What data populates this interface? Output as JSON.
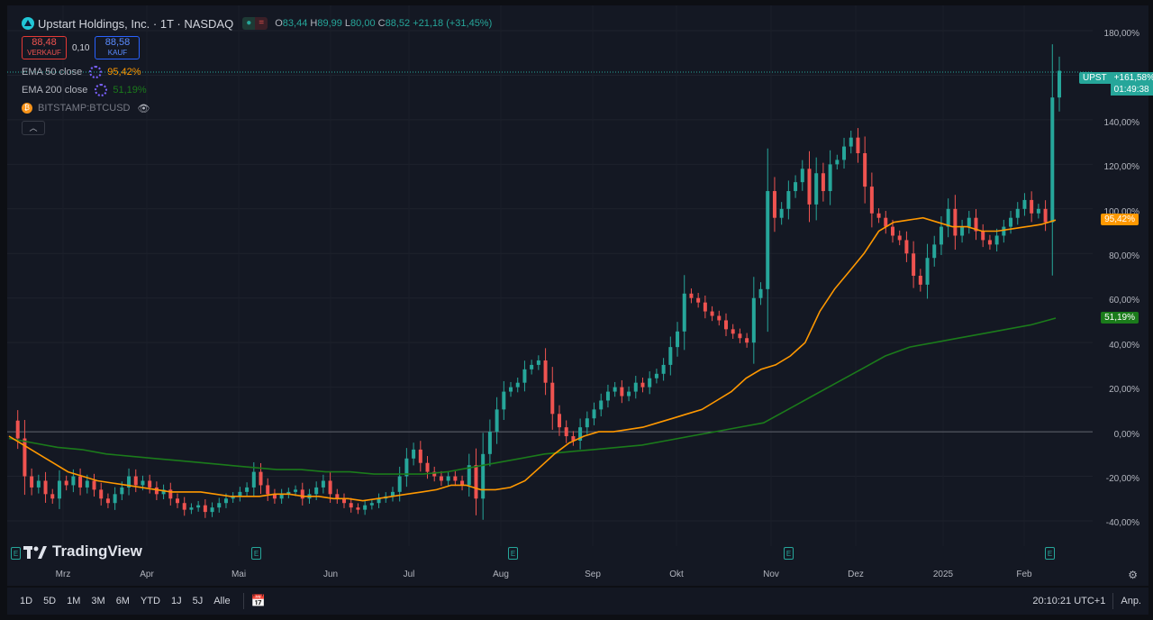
{
  "header": {
    "title": "Upstart Holdings, Inc. · 1T · NASDAQ",
    "ohlc": {
      "o_label": "O",
      "o": "83,44",
      "h_label": "H",
      "h": "89,99",
      "l_label": "L",
      "l": "80,00",
      "c_label": "C",
      "c": "88,52",
      "change": "+21,18 (+31,45%)"
    },
    "sell": {
      "price": "88,48",
      "label": "VERKAUF"
    },
    "spread": "0,10",
    "buy": {
      "price": "88,58",
      "label": "KAUF"
    },
    "indicators": [
      {
        "name": "EMA 50 close",
        "value": "95,42%",
        "color": "#ff9800"
      },
      {
        "name": "EMA 200 close",
        "value": "51,19%",
        "color": "#1b7b1b"
      }
    ],
    "compare": "BITSTAMP:BTCUSD",
    "collapse_icon": "chevron-up-icon"
  },
  "y_axis": {
    "ticks": [
      "180,00%",
      "160,00%",
      "140,00%",
      "120,00%",
      "100,00%",
      "80,00%",
      "60,00%",
      "40,00%",
      "20,00%",
      "0,00%",
      "-20,00%",
      "-40,00%"
    ],
    "range": [
      -42,
      182
    ]
  },
  "x_axis": {
    "ticks": [
      "Mrz",
      "Apr",
      "Mai",
      "Jun",
      "Jul",
      "Aug",
      "Sep",
      "Okt",
      "Nov",
      "Dez",
      "2025",
      "Feb"
    ]
  },
  "price_labels": {
    "symbol": "UPST",
    "value": "+161,58%",
    "countdown": "01:49:38",
    "symbol_color": "#26a69a",
    "ema50": "95,42%",
    "ema50_color": "#ff9800",
    "ema200": "51,19%",
    "ema200_color": "#1b7b1b"
  },
  "earnings_marker": "E",
  "watermark": "TradingView",
  "bottom_bar": {
    "ranges": [
      "1D",
      "5D",
      "1M",
      "3M",
      "6M",
      "YTD",
      "1J",
      "5J",
      "Alle"
    ],
    "time": "20:10:21 UTC+1",
    "adjust": "Anp."
  },
  "colors": {
    "up": "#26a69a",
    "down": "#ef5350",
    "background": "#141823"
  },
  "chart_data": {
    "type": "candlestick",
    "y_unit": "%",
    "ylim": [
      -42,
      182
    ],
    "series": [
      {
        "name": "UPST",
        "type": "candlestick",
        "values": [
          5,
          -3,
          -20,
          -25,
          -22,
          -28,
          -30,
          -22,
          -24,
          -20,
          -25,
          -22,
          -26,
          -30,
          -32,
          -28,
          -25,
          -20,
          -24,
          -22,
          -25,
          -28,
          -26,
          -30,
          -32,
          -35,
          -34,
          -33,
          -36,
          -34,
          -32,
          -30,
          -29,
          -27,
          -25,
          -18,
          -24,
          -28,
          -30,
          -28,
          -27,
          -26,
          -30,
          -28,
          -25,
          -22,
          -28,
          -30,
          -32,
          -34,
          -35,
          -33,
          -32,
          -30,
          -29,
          -27,
          -20,
          -12,
          -8,
          -14,
          -18,
          -20,
          -22,
          -20,
          -22,
          -24,
          -15,
          -30,
          -10,
          0,
          10,
          18,
          20,
          22,
          28,
          30,
          32,
          22,
          8,
          2,
          -2,
          -4,
          2,
          6,
          10,
          14,
          18,
          20,
          16,
          18,
          22,
          20,
          24,
          26,
          30,
          38,
          45,
          62,
          60,
          58,
          54,
          52,
          50,
          46,
          44,
          42,
          40,
          60,
          64,
          108,
          96,
          100,
          108,
          112,
          118,
          102,
          116,
          108,
          120,
          122,
          128,
          132,
          125,
          110,
          98,
          96,
          92,
          88,
          86,
          80,
          70,
          66,
          78,
          84,
          92,
          100,
          88,
          92,
          96,
          90,
          86,
          84,
          88,
          92,
          96,
          100,
          104,
          98,
          100,
          94,
          150,
          162
        ]
      },
      {
        "name": "EMA 50 close",
        "type": "line",
        "color": "#ff9800",
        "values": [
          -2,
          -6,
          -10,
          -14,
          -18,
          -20,
          -22,
          -23,
          -24,
          -25,
          -26,
          -27,
          -27,
          -27,
          -28,
          -29,
          -29,
          -29,
          -28,
          -28,
          -29,
          -29,
          -30,
          -30,
          -31,
          -30,
          -29,
          -28,
          -27,
          -26,
          -24,
          -24,
          -26,
          -26,
          -25,
          -22,
          -16,
          -10,
          -5,
          -2,
          0,
          0,
          1,
          2,
          4,
          6,
          8,
          10,
          14,
          18,
          24,
          28,
          30,
          34,
          40,
          54,
          64,
          72,
          80,
          90,
          94,
          95,
          96,
          94,
          92,
          92,
          90,
          90,
          91,
          92,
          93,
          95
        ]
      },
      {
        "name": "EMA 200 close",
        "type": "line",
        "color": "#1b7b1b",
        "values": [
          -3,
          -5,
          -7,
          -8,
          -10,
          -11,
          -12,
          -13,
          -14,
          -15,
          -16,
          -17,
          -17,
          -18,
          -18,
          -19,
          -19,
          -19,
          -18,
          -16,
          -14,
          -12,
          -10,
          -9,
          -8,
          -7,
          -6,
          -4,
          -2,
          0,
          2,
          4,
          10,
          16,
          22,
          28,
          34,
          38,
          40,
          42,
          44,
          46,
          48,
          51
        ]
      }
    ]
  }
}
